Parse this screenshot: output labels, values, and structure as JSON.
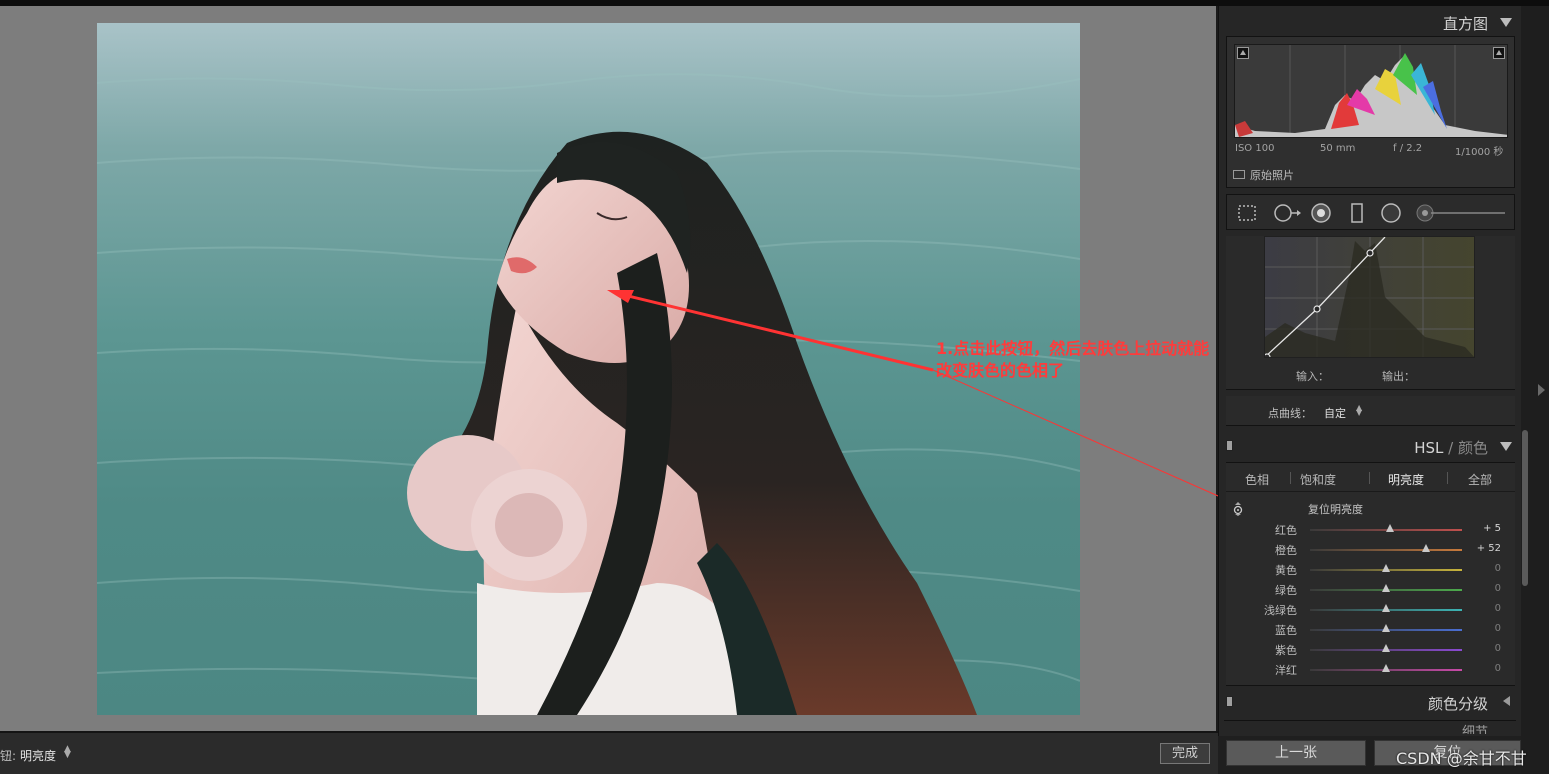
{
  "annotation": {
    "line1": "1.点击此按钮，然后去肤色上拉动就能",
    "line2": "改变肤色的色相了",
    "color": "#ff3b3b"
  },
  "toolbar": {
    "tool_label": "钮:",
    "tool_value": "明亮度",
    "done_label": "完成"
  },
  "histogram": {
    "title": "直方图",
    "iso": "ISO 100",
    "focal": "50 mm",
    "aperture": "f / 2.2",
    "shutter": "1/1000 秒",
    "original_label": "原始照片"
  },
  "tools": [
    "crop-overlay-icon",
    "spot-removal-icon",
    "red-eye-icon",
    "graduated-filter-icon",
    "radial-filter-icon",
    "adjustment-brush-icon"
  ],
  "tone_curve": {
    "input_label": "输入：",
    "output_label": "输出：",
    "point_curve_label": "点曲线：",
    "point_curve_value": "自定"
  },
  "hsl": {
    "title_hsl": "HSL",
    "title_sep": " / ",
    "title_color": "颜色",
    "tabs": [
      {
        "label": "色相",
        "active": false
      },
      {
        "label": "饱和度",
        "active": false
      },
      {
        "label": "明亮度",
        "active": true
      },
      {
        "label": "全部",
        "active": false
      }
    ],
    "reset_label": "复位明亮度",
    "sliders": [
      {
        "label": "红色",
        "value": "+ 5",
        "level": 5,
        "color": "#c0504d"
      },
      {
        "label": "橙色",
        "value": "+ 52",
        "level": 52,
        "color": "#c87a3c"
      },
      {
        "label": "黄色",
        "value": "0",
        "level": 0,
        "color": "#c8b43c"
      },
      {
        "label": "绿色",
        "value": "0",
        "level": 0,
        "color": "#4caa4c"
      },
      {
        "label": "浅绿色",
        "value": "0",
        "level": 0,
        "color": "#3cb4b4"
      },
      {
        "label": "蓝色",
        "value": "0",
        "level": 0,
        "color": "#4a6ed2"
      },
      {
        "label": "紫色",
        "value": "0",
        "level": 0,
        "color": "#8a4ad2"
      },
      {
        "label": "洋红",
        "value": "0",
        "level": 0,
        "color": "#c84aa8"
      }
    ]
  },
  "split_toning": {
    "title": "颜色分级"
  },
  "detail": {
    "title": "细节"
  },
  "nav": {
    "prev_label": "上一张",
    "next_label": "复位"
  },
  "watermark": "CSDN @余甘不甘"
}
